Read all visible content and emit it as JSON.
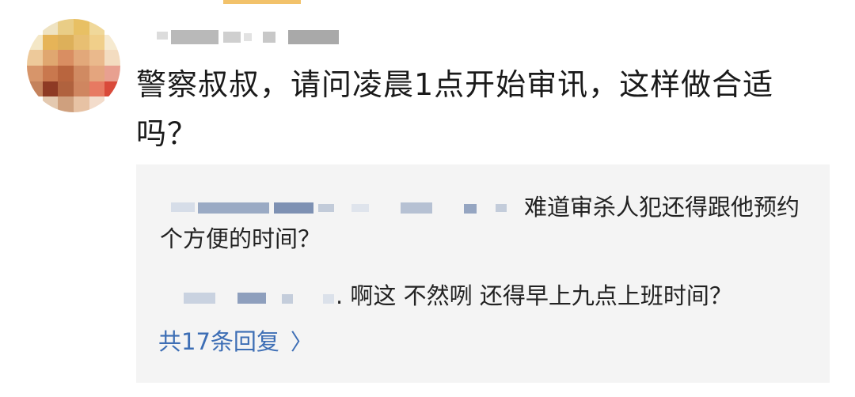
{
  "comment": {
    "text": "警察叔叔，请问凌晨1点开始审讯，这样做合适吗？"
  },
  "replies": [
    {
      "text": "难道审杀人犯还得跟他预约个方便的时间？"
    },
    {
      "text": ". 啊这 不然咧 还得早上九点上班时间？"
    }
  ],
  "more_replies": {
    "label": "共17条回复",
    "icon": "chevron-right-icon"
  },
  "colors": {
    "link": "#3d6eb5",
    "reply_bg": "#f4f4f4",
    "tab_accent": "#f2c26b"
  }
}
